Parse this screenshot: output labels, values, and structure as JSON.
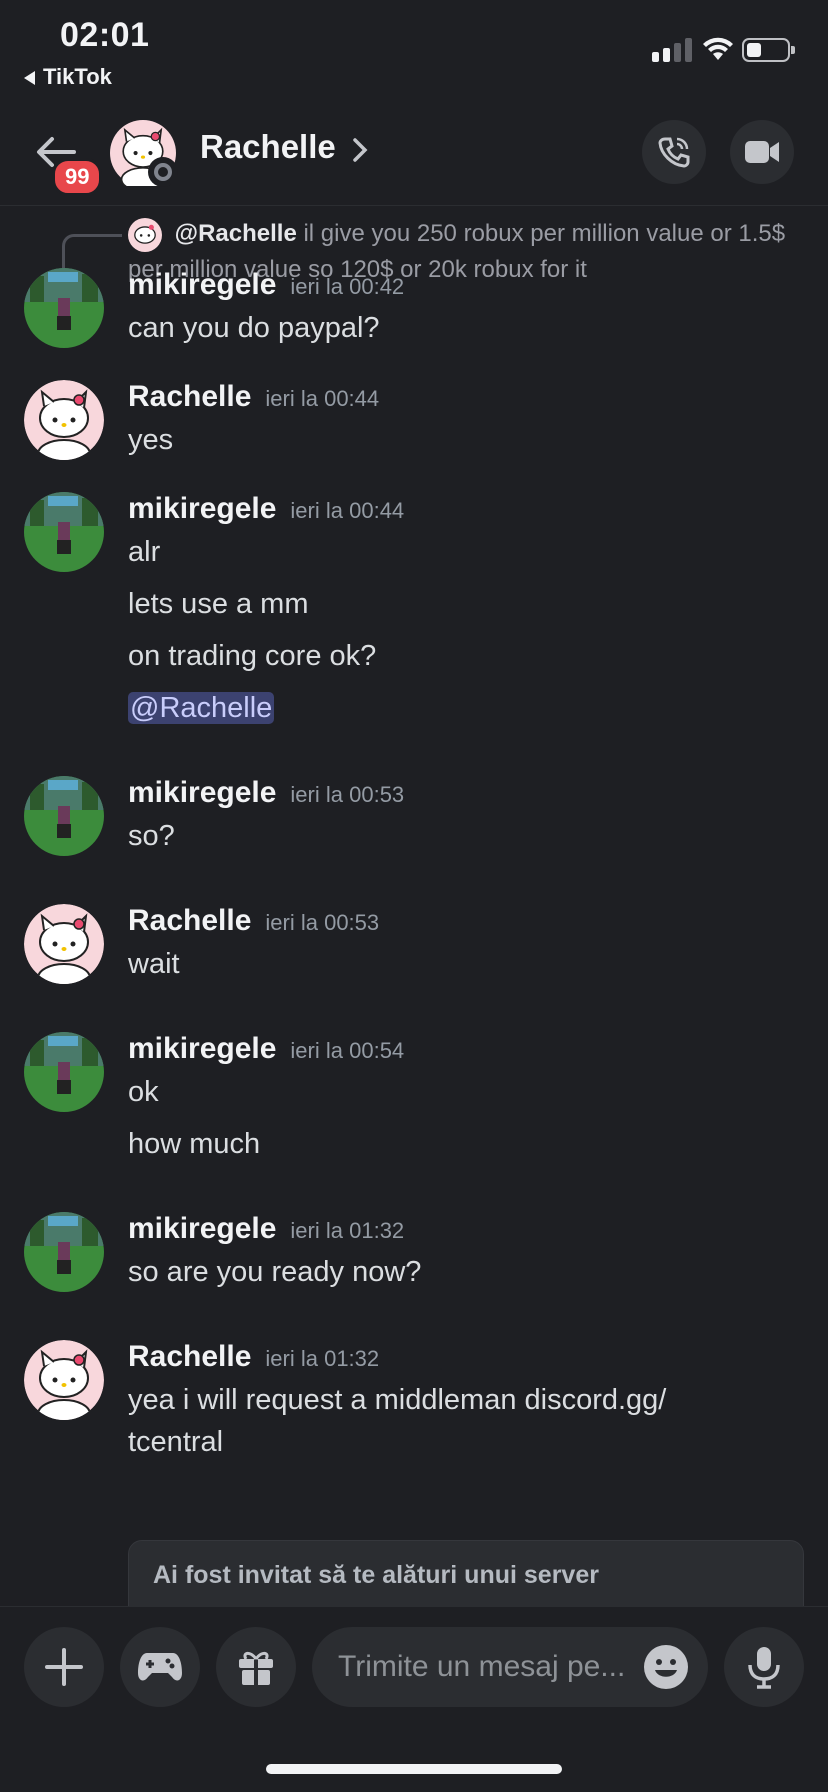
{
  "status_bar": {
    "time": "02:01",
    "back_app": "TikTok"
  },
  "header": {
    "name": "Rachelle",
    "badge": "99"
  },
  "reply": {
    "author": "@Rachelle",
    "text": "il give you 250 robux per million value or 1.5$ per million value so 120$ or 20k robux for it"
  },
  "messages": [
    {
      "author": "mikiregele",
      "time": "ieri la 00:42",
      "lines": [
        "can you do paypal?"
      ]
    },
    {
      "author": "Rachelle",
      "time": "ieri la 00:44",
      "lines": [
        "yes"
      ]
    },
    {
      "author": "mikiregele",
      "time": "ieri la 00:44",
      "lines": [
        "alr",
        "lets use a mm",
        "on trading core ok?"
      ],
      "mention": "@Rachelle"
    },
    {
      "author": "mikiregele",
      "time": "ieri la 00:53",
      "lines": [
        "so?"
      ]
    },
    {
      "author": "Rachelle",
      "time": "ieri la 00:53",
      "lines": [
        "wait"
      ]
    },
    {
      "author": "mikiregele",
      "time": "ieri la 00:54",
      "lines": [
        "ok",
        "how much"
      ]
    },
    {
      "author": "mikiregele",
      "time": "ieri la 01:32",
      "lines": [
        "so are you ready now?"
      ]
    },
    {
      "author": "Rachelle",
      "time": "ieri la 01:32",
      "lines": [
        "yea i will request a middleman discord.gg/",
        "tcentral"
      ]
    }
  ],
  "invite": {
    "text": "Ai fost invitat să te alături unui server"
  },
  "composer": {
    "placeholder": "Trimite un mesaj pe..."
  },
  "colors": {
    "background": "#1e1f23",
    "surface": "#2b2d31",
    "badge": "#e8474b",
    "mention_bg": "#3c4270"
  }
}
